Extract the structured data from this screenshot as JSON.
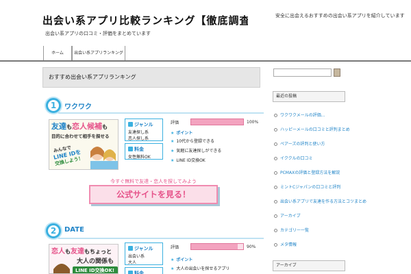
{
  "header": {
    "title": "出会い系アプリ比較ランキング【徹底調査】",
    "description": "出会い系アプリの口コミ・評価をまとめています",
    "right_text": "安全に出会えるおすすめの出会い系アプリを紹介しています"
  },
  "nav": {
    "items": [
      {
        "label": "ホーム"
      },
      {
        "label": "出会い系アプリランキング"
      }
    ]
  },
  "main": {
    "title": "おすすめ出会い系アプリランキング",
    "cta_text": "今すぐ無料で友達・恋人を探してみよう",
    "cta_label": "公式サイトを見る！",
    "ranks": [
      {
        "number": "1",
        "name": "ワクワク",
        "banner": {
          "line1a": "友達",
          "line1b": "も",
          "line1c": "恋人候補",
          "line1d": "も",
          "line2": "目的に合わせて相手を探せる",
          "line3": "みんなで",
          "line4": "LINE IDを",
          "line5": "交換しよう！"
        },
        "genre_label": "ジャンル",
        "genre_values": [
          "友達探し系",
          "恋人探し系"
        ],
        "price_label": "料金",
        "price_value": "女性無料OK",
        "score_label": "評価",
        "score_pct": "100%",
        "score_value": 1.0,
        "point_label": "ポイント",
        "points": [
          "10代から登録できる",
          "気軽に友達探しができる",
          "LINE ID交換OK"
        ]
      },
      {
        "number": "2",
        "name": "DATE",
        "banner": {
          "line1a": "恋人",
          "line1b": "も",
          "line1c": "友達",
          "line1d": "もちょっと",
          "line2": "大人の関係も",
          "line3": "LINE ID交換OK!"
        },
        "genre_label": "ジャンル",
        "genre_values": [
          "出会い系",
          "大人"
        ],
        "price_label": "料金",
        "price_value": "",
        "score_label": "評価",
        "score_pct": "90%",
        "score_value": 0.9,
        "point_label": "ポイント",
        "points": [
          "大人の出会いを探せるアプリ"
        ]
      }
    ]
  },
  "sidebar": {
    "search_placeholder": "",
    "widget1_title": "最近の投稿",
    "items": [
      "ワクワクメールの評価...",
      "ハッピーメールの口コミと評判まとめ",
      "ペアーズの評判と使い方",
      "イククルの口コミ",
      "PCMAXの評価と登録方法を解説",
      "ミントCジャパンの口コミと評判",
      "出会い系アプリで友達を作る方法とコツまとめ",
      "アーカイブ",
      "カテゴリー一覧",
      "メタ情報"
    ],
    "widget2_title": "アーカイブ"
  },
  "colors": {
    "accent_blue": "#3ab0e0",
    "link_blue": "#1e83c7",
    "cta_pink": "#e6538a",
    "bar_pink": "#f3a3bf"
  }
}
